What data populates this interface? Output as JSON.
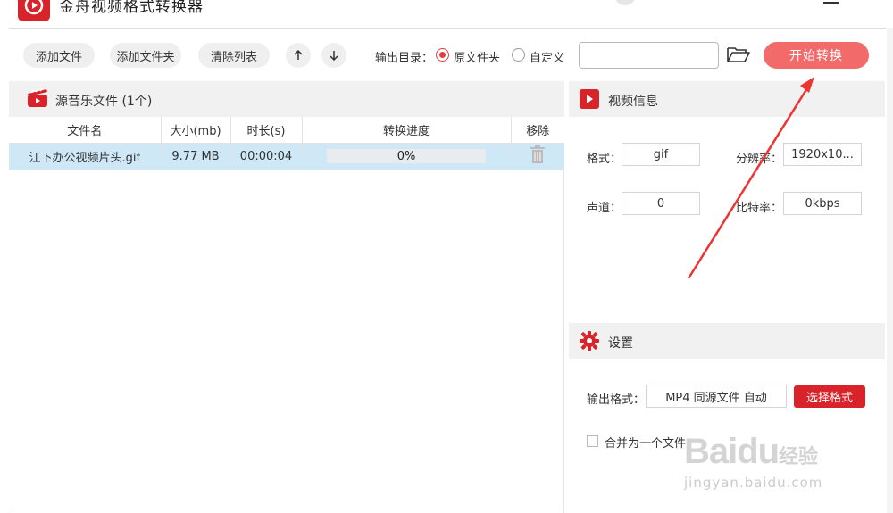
{
  "app": {
    "title": "金舟视频格式转换器",
    "accent_color": "#d8232a",
    "logo_icon": "app-logo-icon"
  },
  "toolbar": {
    "add_file": "添加文件",
    "add_folder": "添加文件夹",
    "clear_list": "清除列表",
    "move_up_icon": "arrow-up-icon",
    "move_down_icon": "arrow-down-icon",
    "output_dir_label": "输出目录：",
    "output_options": [
      {
        "label": "原文件夹",
        "selected": true
      },
      {
        "label": "自定义",
        "selected": false
      }
    ],
    "custom_path_value": "",
    "folder_icon": "folder-open-icon",
    "start_button": "开始转换",
    "start_button_color": "#f26a6a"
  },
  "file_panel": {
    "header_label": "源音乐文件 (1个)",
    "header_icon": "film-clapper-icon",
    "columns": [
      "文件名",
      "大小(mb)",
      "时长(s)",
      "转换进度",
      "移除"
    ],
    "rows": [
      {
        "name": "江下办公视频片头.gif",
        "size": "9.77 MB",
        "duration": "00:00:04",
        "progress": "0%",
        "progress_fraction": 0,
        "remove_icon": "trash-icon"
      }
    ]
  },
  "video_info": {
    "header_label": "视频信息",
    "header_icon": "play-icon",
    "format_label": "格式：",
    "format_value": "gif",
    "resolution_label": "分辨率：",
    "resolution_value": "1920x10...",
    "channels_label": "声道：",
    "channels_value": "0",
    "bitrate_label": "比特率：",
    "bitrate_value": "0kbps"
  },
  "settings": {
    "header_label": "设置",
    "header_icon": "gear-icon",
    "output_format_label": "输出格式：",
    "output_format_value": "MP4 同源文件 自动",
    "choose_format_button": "选择格式",
    "merge_label": "合并为一个文件",
    "merge_checked": false
  },
  "watermark": {
    "main": "Bai",
    "du": "du",
    "cn": "经验",
    "url": "jingyan.baidu.com"
  }
}
